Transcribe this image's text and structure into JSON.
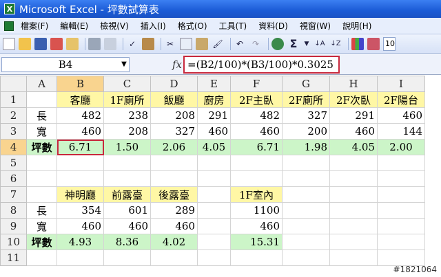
{
  "window": {
    "title": "Microsoft Excel - 坪數試算表",
    "app_icon_letter": "X"
  },
  "menu": [
    "檔案(F)",
    "編輯(E)",
    "檢視(V)",
    "插入(I)",
    "格式(O)",
    "工具(T)",
    "資料(D)",
    "視窗(W)",
    "說明(H)"
  ],
  "toolbar": {
    "zoom": "10",
    "sigma": "Σ",
    "sort_asc": "↓A",
    "sort_desc": "↓Z"
  },
  "formula_bar": {
    "cell_ref": "B4",
    "fx": "fx",
    "formula": "=(B2/100)*(B3/100)*0.3025"
  },
  "columns": [
    "A",
    "B",
    "C",
    "D",
    "E",
    "F",
    "G",
    "H",
    "I"
  ],
  "row_numbers": [
    "1",
    "2",
    "3",
    "4",
    "5",
    "6",
    "7",
    "8",
    "9",
    "10",
    "11"
  ],
  "cells": {
    "B1": "客廳",
    "C1": "1F廁所",
    "D1": "飯廳",
    "E1": "廚房",
    "F1": "2F主臥",
    "G1": "2F廁所",
    "H1": "2F次臥",
    "I1": "2F陽台",
    "A2": "長",
    "B2": "482",
    "C2": "238",
    "D2": "208",
    "E2": "291",
    "F2": "482",
    "G2": "327",
    "H2": "291",
    "I2": "460",
    "A3": "寬",
    "B3": "460",
    "C3": "208",
    "D3": "327",
    "E3": "460",
    "F3": "460",
    "G3": "200",
    "H3": "460",
    "I3": "144",
    "A4": "坪數",
    "B4": "6.71",
    "C4": "1.50",
    "D4": "2.06",
    "E4": "4.05",
    "F4": "6.71",
    "G4": "1.98",
    "H4": "4.05",
    "I4": "2.00",
    "B7": "神明廳",
    "C7": "前露臺",
    "D7": "後露臺",
    "F7": "1F室內",
    "A8": "長",
    "B8": "354",
    "C8": "601",
    "D8": "289",
    "F8": "1100",
    "A9": "寬",
    "B9": "460",
    "C9": "460",
    "D9": "460",
    "F9": "460",
    "A10": "坪數",
    "B10": "4.93",
    "C10": "8.36",
    "D10": "4.02",
    "F10": "15.31"
  },
  "watermark": "#1821064"
}
